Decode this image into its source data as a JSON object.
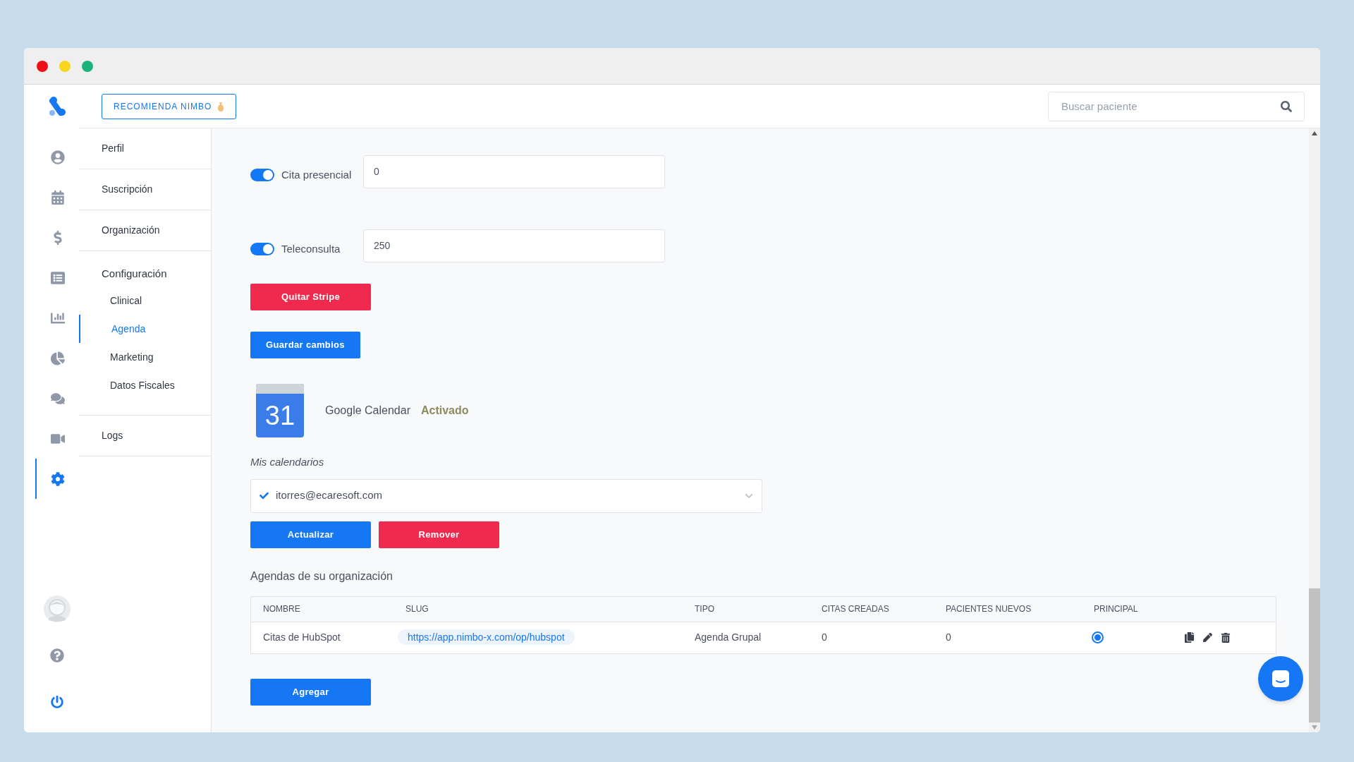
{
  "topbar": {
    "recommend_button": "RECOMIENDA NIMBO",
    "search": {
      "placeholder": "Buscar paciente"
    }
  },
  "rail": [
    {
      "kind": "patients",
      "selected": false
    },
    {
      "kind": "calendar",
      "selected": false
    },
    {
      "kind": "billing",
      "selected": false
    },
    {
      "kind": "records",
      "selected": false
    },
    {
      "kind": "reports",
      "selected": false
    },
    {
      "kind": "analytics",
      "selected": false
    },
    {
      "kind": "chat",
      "selected": false
    },
    {
      "kind": "video",
      "selected": false
    },
    {
      "kind": "settings",
      "selected": true
    }
  ],
  "rail_bottom": [
    {
      "kind": "avatar"
    },
    {
      "kind": "help"
    },
    {
      "kind": "logout"
    }
  ],
  "settings_nav": [
    {
      "label": "Perfil",
      "selected": false
    },
    {
      "label": "Suscripción",
      "selected": false
    },
    {
      "label": "Organización",
      "selected": false
    },
    {
      "label": "Configuración",
      "selected": false,
      "children": [
        {
          "label": "Clinical",
          "selected": false
        },
        {
          "label": "Agenda",
          "selected": true
        },
        {
          "label": "Marketing",
          "selected": false
        },
        {
          "label": "Datos Fiscales",
          "selected": false
        }
      ]
    },
    {
      "label": "Logs",
      "selected": false
    }
  ],
  "prices": [
    {
      "label": "Cita presencial",
      "on": true,
      "value": "0"
    },
    {
      "label": "Teleconsulta",
      "on": true,
      "value": "250"
    }
  ],
  "stripe_button": "Quitar Stripe",
  "save_button": "Guardar cambios",
  "google_calendar": {
    "icon_day": "31",
    "name": "Google Calendar",
    "status": "Activado"
  },
  "calendars": {
    "label": "Mis calendarios",
    "value": "itorres@ecaresoft.com",
    "buttons": [
      {
        "label": "Actualizar",
        "kind": "primary"
      },
      {
        "label": "Remover",
        "kind": "danger"
      }
    ]
  },
  "agendas": {
    "title": "Agendas de su organización",
    "columns": [
      "NOMBRE",
      "SLUG",
      "TIPO",
      "CITAS CREADAS",
      "PACIENTES NUEVOS",
      "PRINCIPAL"
    ],
    "rows": [
      {
        "nombre": "Citas de HubSpot",
        "slug": "https://app.nimbo-x.com/op/hubspot",
        "tipo": "Agenda Grupal",
        "citas": "0",
        "pacientes": "0",
        "principal": true
      }
    ]
  },
  "add_button": "Agregar"
}
